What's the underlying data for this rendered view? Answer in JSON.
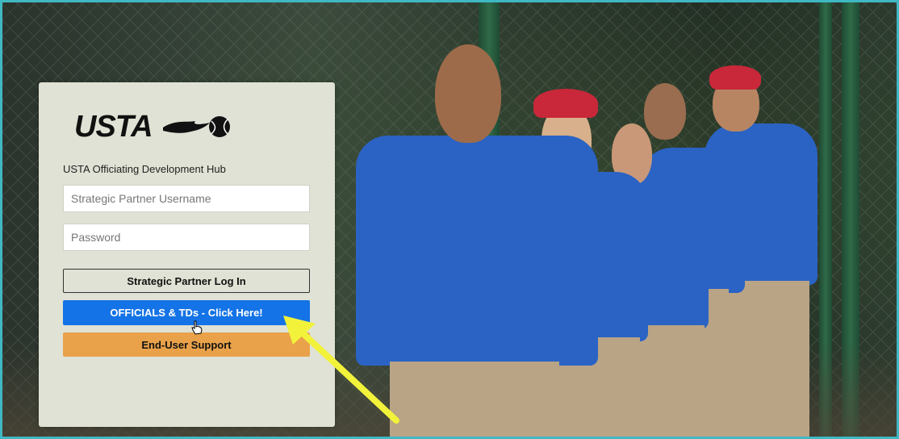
{
  "brand": {
    "logo_text": "USTA",
    "subtitle": "USTA Officiating Development Hub"
  },
  "form": {
    "username_placeholder": "Strategic Partner Username",
    "password_placeholder": "Password",
    "login_label": "Strategic Partner Log In",
    "officials_label": "OFFICIALS & TDs - Click Here!",
    "support_label": "End-User Support"
  },
  "colors": {
    "frame_border": "#3fb8c4",
    "panel_bg": "#dfe2d4",
    "officials_button": "#1473e6",
    "support_button": "#e9a24a",
    "annotation_arrow": "#f2f23a"
  },
  "icons": {
    "cursor": "hand-pointer-icon",
    "annotation": "arrow-icon"
  }
}
